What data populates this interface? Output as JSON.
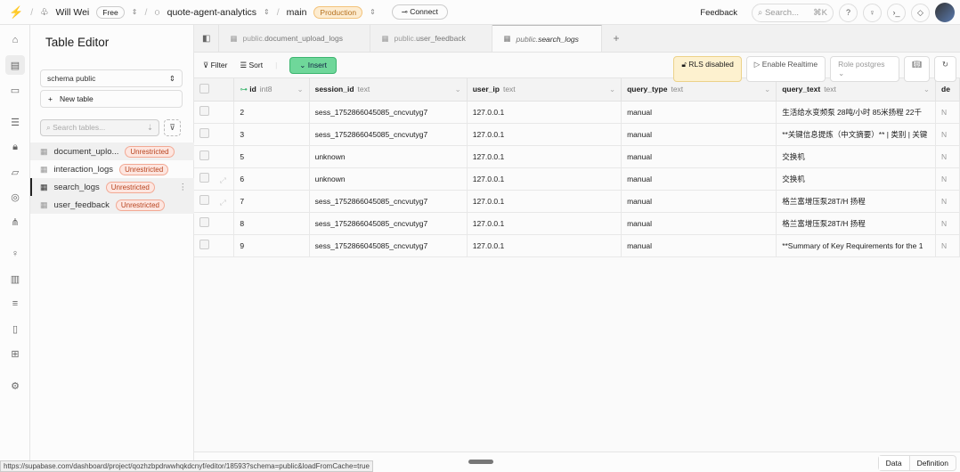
{
  "topbar": {
    "org": "Will Wei",
    "plan": "Free",
    "project": "quote-agent-analytics",
    "branch": "main",
    "env": "Production",
    "connect": "Connect",
    "feedback": "Feedback",
    "search_placeholder": "Search...",
    "search_shortcut": "⌘K"
  },
  "sidebar": {
    "title": "Table Editor",
    "schema": "schema public",
    "new_table": "New table",
    "search_placeholder": "Search tables...",
    "tables": [
      {
        "name": "document_uplo...",
        "badge": "Unrestricted"
      },
      {
        "name": "interaction_logs",
        "badge": "Unrestricted"
      },
      {
        "name": "search_logs",
        "badge": "Unrestricted"
      },
      {
        "name": "user_feedback",
        "badge": "Unrestricted"
      }
    ]
  },
  "tabs": [
    {
      "schema": "public.",
      "name": "document_upload_logs"
    },
    {
      "schema": "public.",
      "name": "user_feedback"
    },
    {
      "schema": "public.",
      "name": "search_logs"
    }
  ],
  "toolbar": {
    "filter": "Filter",
    "sort": "Sort",
    "insert": "Insert",
    "rls": "RLS disabled",
    "realtime": "Enable Realtime",
    "role": "Role postgres"
  },
  "columns": [
    {
      "name": "id",
      "type": "int8"
    },
    {
      "name": "session_id",
      "type": "text"
    },
    {
      "name": "user_ip",
      "type": "text"
    },
    {
      "name": "query_type",
      "type": "text"
    },
    {
      "name": "query_text",
      "type": "text"
    },
    {
      "name": "de",
      "type": ""
    }
  ],
  "rows": [
    [
      "2",
      "sess_1752866045085_cncvutyg7",
      "127.0.0.1",
      "manual",
      "生活给水变频泵 28吨/小时 85米扬程 22千",
      "N"
    ],
    [
      "3",
      "sess_1752866045085_cncvutyg7",
      "127.0.0.1",
      "manual",
      "**关键信息提炼（中文摘要）** | 类别 | 关键",
      "N"
    ],
    [
      "5",
      "unknown",
      "127.0.0.1",
      "manual",
      "交换机",
      "N"
    ],
    [
      "6",
      "unknown",
      "127.0.0.1",
      "manual",
      "交换机",
      "N"
    ],
    [
      "7",
      "sess_1752866045085_cncvutyg7",
      "127.0.0.1",
      "manual",
      "格兰富增压泵28T/H 扬程",
      "N"
    ],
    [
      "8",
      "sess_1752866045085_cncvutyg7",
      "127.0.0.1",
      "manual",
      "格兰富增压泵28T/H 扬程",
      "N"
    ],
    [
      "9",
      "sess_1752866045085_cncvutyg7",
      "127.0.0.1",
      "manual",
      "**Summary of Key Requirements for the 1",
      "N"
    ]
  ],
  "footer": {
    "data": "Data",
    "definition": "Definition"
  },
  "status_url": "https://supabase.com/dashboard/project/qozhzbpdrwwhqkdcnyf/editor/18593?schema=public&loadFromCache=true"
}
